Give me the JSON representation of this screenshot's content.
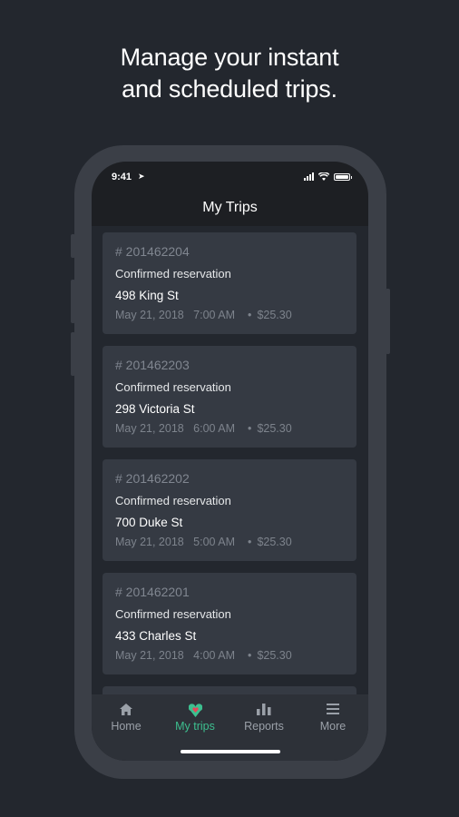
{
  "promo": {
    "line1": "Manage your instant",
    "line2": "and scheduled trips."
  },
  "status_bar": {
    "time": "9:41"
  },
  "header": {
    "title": "My Trips"
  },
  "trips": [
    {
      "id": "# 201462204",
      "status": "Confirmed reservation",
      "address": "498 King St",
      "date": "May 21, 2018",
      "time": "7:00 AM",
      "price": "$25.30"
    },
    {
      "id": "# 201462203",
      "status": "Confirmed reservation",
      "address": "298 Victoria St",
      "date": "May 21, 2018",
      "time": "6:00 AM",
      "price": "$25.30"
    },
    {
      "id": "# 201462202",
      "status": "Confirmed reservation",
      "address": "700 Duke St",
      "date": "May 21, 2018",
      "time": "5:00 AM",
      "price": "$25.30"
    },
    {
      "id": "# 201462201",
      "status": "Confirmed reservation",
      "address": "433 Charles St",
      "date": "May 21, 2018",
      "time": "4:00 AM",
      "price": "$25.30"
    }
  ],
  "tabs": [
    {
      "label": "Home",
      "icon": "home-icon",
      "active": false
    },
    {
      "label": "My trips",
      "icon": "heart-pin-icon",
      "active": true
    },
    {
      "label": "Reports",
      "icon": "bar-chart-icon",
      "active": false
    },
    {
      "label": "More",
      "icon": "menu-icon",
      "active": false
    }
  ],
  "colors": {
    "background": "#23272e",
    "card": "#353a43",
    "accent": "#3dbf8f",
    "heart": "#e8445a"
  }
}
